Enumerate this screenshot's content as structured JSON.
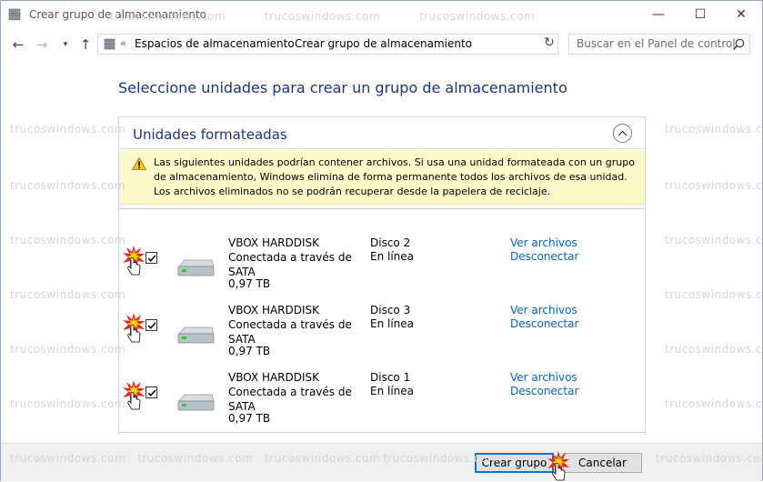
{
  "window": {
    "title": "Crear grupo de almacenamiento",
    "controls": {
      "minimize": "—",
      "maximize": "☐",
      "close": "✕"
    }
  },
  "nav": {
    "back": "←",
    "forward": "→",
    "recent": "▾",
    "up": "↑"
  },
  "address": {
    "overflow": "«",
    "breadcrumb": [
      "Espacios de almacenamiento",
      "Crear grupo de almacenamiento"
    ],
    "separator": "›",
    "refresh": "↻"
  },
  "search": {
    "placeholder": "Buscar en el Panel de control"
  },
  "heading": "Seleccione unidades para crear un grupo de almacenamiento",
  "panel": {
    "title": "Unidades formateadas",
    "warning": "Las siguientes unidades podrían contener archivos. Si usa una unidad formateada con un grupo de almacenamiento, Windows elimina de forma permanente todos los archivos de esa unidad. Los archivos eliminados no se podrán recuperar desde la papelera de reciclaje."
  },
  "drives": [
    {
      "name": "VBOX HARDDISK",
      "connection": "Conectada a través de SATA",
      "size": "0,97 TB",
      "disk": "Disco 2",
      "status": "En línea",
      "view_link": "Ver archivos",
      "disconnect_link": "Desconectar",
      "checked": true
    },
    {
      "name": "VBOX HARDDISK",
      "connection": "Conectada a través de SATA",
      "size": "0,97 TB",
      "disk": "Disco 3",
      "status": "En línea",
      "view_link": "Ver archivos",
      "disconnect_link": "Desconectar",
      "checked": true
    },
    {
      "name": "VBOX HARDDISK",
      "connection": "Conectada a través de SATA",
      "size": "0,97 TB",
      "disk": "Disco 1",
      "status": "En línea",
      "view_link": "Ver archivos",
      "disconnect_link": "Desconectar",
      "checked": true
    }
  ],
  "buttons": {
    "create": "Crear grupo",
    "cancel": "Cancelar"
  },
  "watermark": "trucoswindows.com",
  "colors": {
    "heading": "#1e3287",
    "link": "#0066cc",
    "warning_bg": "#fcfac8",
    "primary_border": "#0078d7"
  }
}
